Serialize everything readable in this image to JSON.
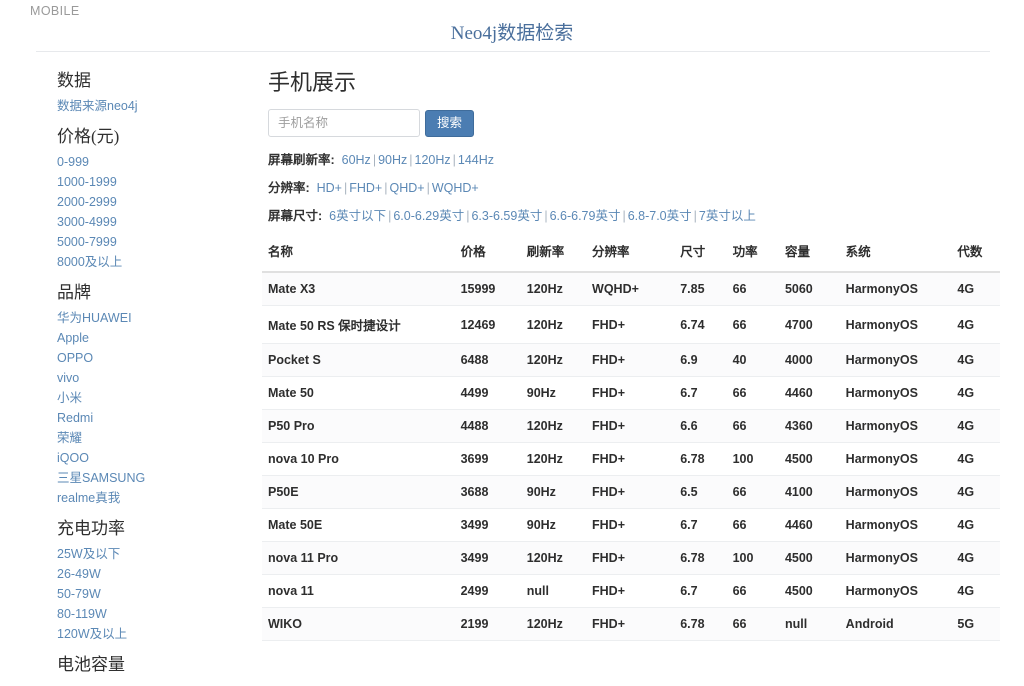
{
  "navbar": {
    "brand": "MOBILE"
  },
  "header": {
    "site_title": "Neo4j数据检索",
    "title_color": "#4a6f9c"
  },
  "sidebar": {
    "groups": [
      {
        "title": "数据",
        "links": [
          "数据来源neo4j"
        ]
      },
      {
        "title": "价格(元)",
        "links": [
          "0-999",
          "1000-1999",
          "2000-2999",
          "3000-4999",
          "5000-7999",
          "8000及以上"
        ]
      },
      {
        "title": "品牌",
        "links": [
          "华为HUAWEI",
          "Apple",
          "OPPO",
          "vivo",
          "小米",
          "Redmi",
          "荣耀",
          "iQOO",
          "三星SAMSUNG",
          "realme真我"
        ]
      },
      {
        "title": "充电功率",
        "links": [
          "25W及以下",
          "26-49W",
          "50-79W",
          "80-119W",
          "120W及以上"
        ]
      },
      {
        "title": "电池容量",
        "links": []
      }
    ]
  },
  "main": {
    "title": "手机展示",
    "search": {
      "placeholder": "手机名称",
      "value": "",
      "button_label": "搜索",
      "button_color": "#4b7db2"
    },
    "filters": [
      {
        "label": "屏幕刷新率:",
        "options": [
          "60Hz",
          "90Hz",
          "120Hz",
          "144Hz"
        ]
      },
      {
        "label": "分辨率:",
        "options": [
          "HD+",
          "FHD+",
          "QHD+",
          "WQHD+"
        ]
      },
      {
        "label": "屏幕尺寸:",
        "options": [
          "6英寸以下",
          "6.0-6.29英寸",
          "6.3-6.59英寸",
          "6.6-6.79英寸",
          "6.8-7.0英寸",
          "7英寸以上"
        ]
      }
    ],
    "table": {
      "columns": [
        "名称",
        "价格",
        "刷新率",
        "分辨率",
        "尺寸",
        "功率",
        "容量",
        "系统",
        "代数"
      ],
      "rows": [
        [
          "Mate X3",
          "15999",
          "120Hz",
          "WQHD+",
          "7.85",
          "66",
          "5060",
          "HarmonyOS",
          "4G"
        ],
        [
          "Mate 50 RS 保时捷设计",
          "12469",
          "120Hz",
          "FHD+",
          "6.74",
          "66",
          "4700",
          "HarmonyOS",
          "4G"
        ],
        [
          "Pocket S",
          "6488",
          "120Hz",
          "FHD+",
          "6.9",
          "40",
          "4000",
          "HarmonyOS",
          "4G"
        ],
        [
          "Mate 50",
          "4499",
          "90Hz",
          "FHD+",
          "6.7",
          "66",
          "4460",
          "HarmonyOS",
          "4G"
        ],
        [
          "P50 Pro",
          "4488",
          "120Hz",
          "FHD+",
          "6.6",
          "66",
          "4360",
          "HarmonyOS",
          "4G"
        ],
        [
          "nova 10 Pro",
          "3699",
          "120Hz",
          "FHD+",
          "6.78",
          "100",
          "4500",
          "HarmonyOS",
          "4G"
        ],
        [
          "P50E",
          "3688",
          "90Hz",
          "FHD+",
          "6.5",
          "66",
          "4100",
          "HarmonyOS",
          "4G"
        ],
        [
          "Mate 50E",
          "3499",
          "90Hz",
          "FHD+",
          "6.7",
          "66",
          "4460",
          "HarmonyOS",
          "4G"
        ],
        [
          "nova 11 Pro",
          "3499",
          "120Hz",
          "FHD+",
          "6.78",
          "100",
          "4500",
          "HarmonyOS",
          "4G"
        ],
        [
          "nova 11",
          "2499",
          "null",
          "FHD+",
          "6.7",
          "66",
          "4500",
          "HarmonyOS",
          "4G"
        ],
        [
          "WIKO",
          "2199",
          "120Hz",
          "FHD+",
          "6.78",
          "66",
          "null",
          "Android",
          "5G"
        ]
      ]
    }
  }
}
